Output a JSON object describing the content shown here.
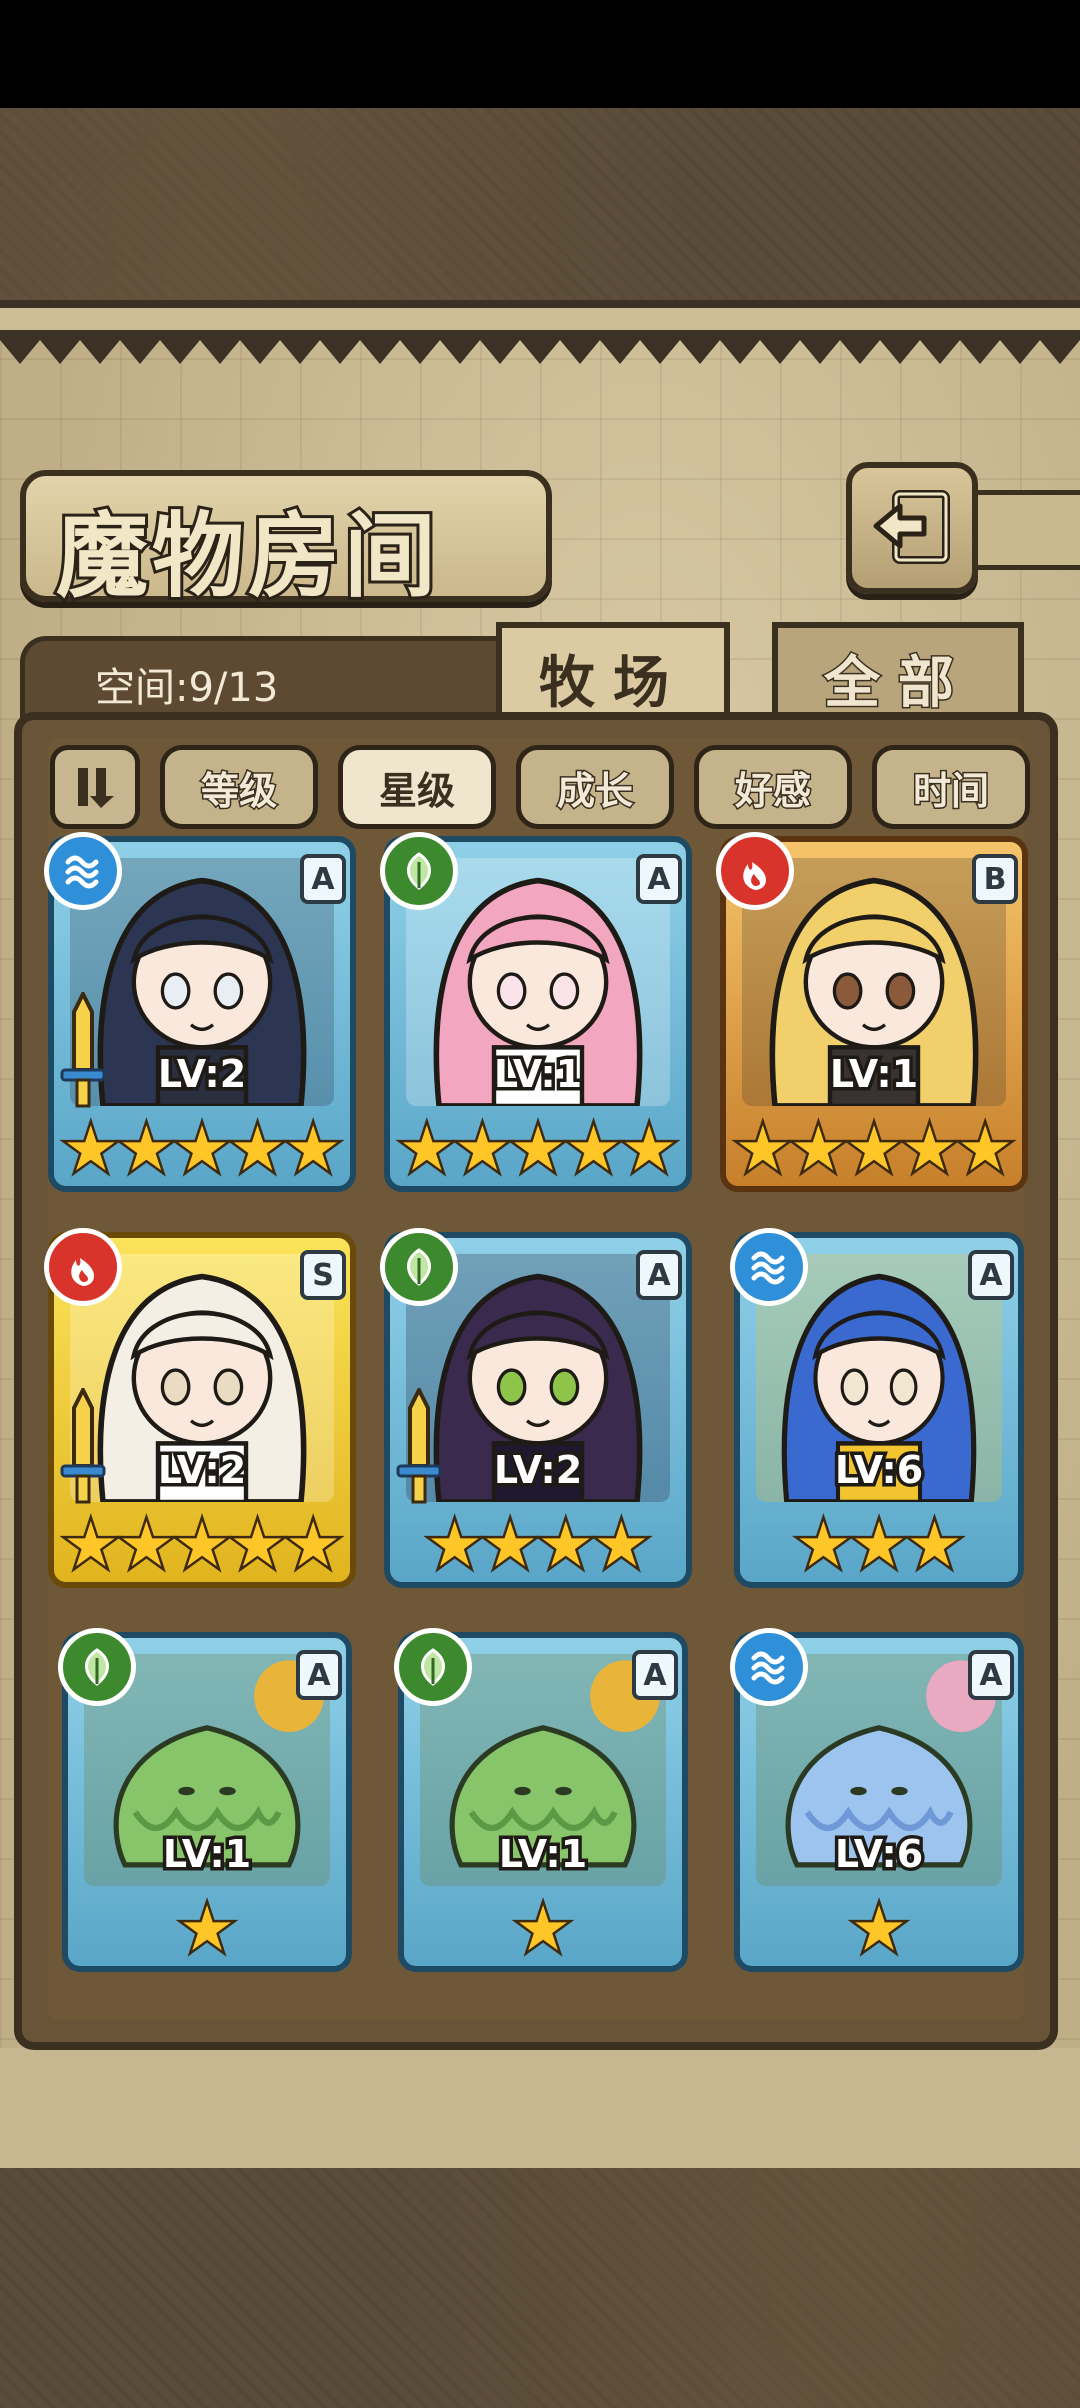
{
  "title": "魔物房间",
  "space_label": "空间:9/13",
  "tabs": [
    {
      "label": "牧场",
      "active": true
    },
    {
      "label": "全部",
      "active": false
    }
  ],
  "sort_buttons": [
    {
      "label": "等级",
      "active": false
    },
    {
      "label": "星级",
      "active": true
    },
    {
      "label": "成长",
      "active": false
    },
    {
      "label": "好感",
      "active": false
    },
    {
      "label": "时间",
      "active": false
    }
  ],
  "monsters": [
    {
      "level": "LV:2",
      "rank": "A",
      "element": "water",
      "stars": 5,
      "frame": "blue",
      "weapon": true,
      "art": "pirate-girl"
    },
    {
      "level": "LV:1",
      "rank": "A",
      "element": "nature",
      "stars": 5,
      "frame": "blue",
      "weapon": false,
      "art": "pink-maid-girl"
    },
    {
      "level": "LV:1",
      "rank": "B",
      "element": "fire",
      "stars": 5,
      "frame": "gold",
      "weapon": false,
      "art": "tan-blonde-girl"
    },
    {
      "level": "LV:2",
      "rank": "S",
      "element": "fire",
      "stars": 5,
      "frame": "yellow",
      "weapon": true,
      "art": "white-hat-girl"
    },
    {
      "level": "LV:2",
      "rank": "A",
      "element": "nature",
      "stars": 4,
      "frame": "blue",
      "weapon": true,
      "art": "insect-girl"
    },
    {
      "level": "LV:6",
      "rank": "A",
      "element": "water",
      "stars": 3,
      "frame": "blue",
      "weapon": false,
      "art": "blue-cat-girl"
    },
    {
      "level": "LV:1",
      "rank": "A",
      "element": "nature",
      "stars": 1,
      "frame": "blue",
      "weapon": false,
      "art": "green-slime"
    },
    {
      "level": "LV:1",
      "rank": "A",
      "element": "nature",
      "stars": 1,
      "frame": "blue",
      "weapon": false,
      "art": "green-slime"
    },
    {
      "level": "LV:6",
      "rank": "A",
      "element": "water",
      "stars": 1,
      "frame": "blue",
      "weapon": false,
      "art": "blue-slime"
    }
  ],
  "colors": {
    "water": "#2f8fd8",
    "nature": "#3d8a2e",
    "fire": "#d8342c",
    "star": "#ffc627"
  }
}
